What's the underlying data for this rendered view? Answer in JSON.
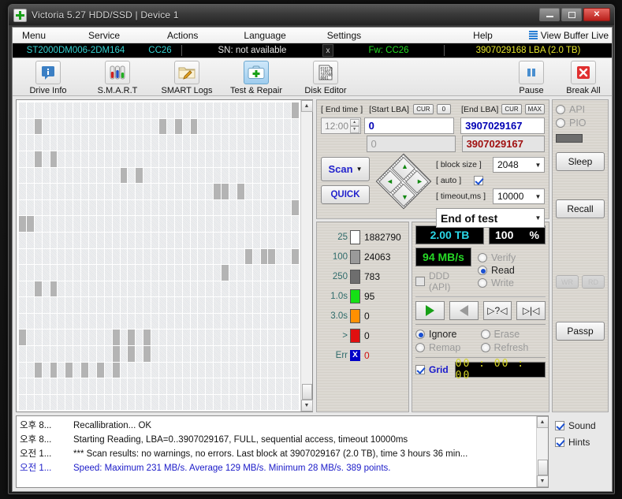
{
  "window": {
    "title": "Victoria 5.27 HDD/SSD | Device 1",
    "app_icon": "green-cross-icon",
    "minimize": "minimize-icon",
    "maximize": "maximize-icon",
    "close": "✕"
  },
  "menubar": {
    "items": [
      "Menu",
      "Service",
      "Actions",
      "Language",
      "Settings",
      "Help"
    ],
    "view_buffer_live": "View Buffer Live"
  },
  "drivebar": {
    "model": "ST2000DM006-2DM164",
    "revision": "CC26",
    "serial": "SN: not available",
    "x_button": "x",
    "firmware": "Fw: CC26",
    "capacity": "3907029168 LBA (2.0 TB)"
  },
  "toolbar": {
    "buttons": [
      {
        "label": "Drive Info",
        "icon": "info-icon",
        "selected": false
      },
      {
        "label": "S.M.A.R.T",
        "icon": "test-tubes-icon",
        "selected": false
      },
      {
        "label": "SMART Logs",
        "icon": "folder-pencil-icon",
        "selected": false
      },
      {
        "label": "Test & Repair",
        "icon": "first-aid-kit-icon",
        "selected": true
      },
      {
        "label": "Disk Editor",
        "icon": "binary-page-icon",
        "selected": false
      }
    ],
    "pause": {
      "label": "Pause",
      "icon": "pause-icon"
    },
    "break_all": {
      "label": "Break All",
      "icon": "red-x-icon"
    }
  },
  "params": {
    "end_time_label": "[ End time ]",
    "end_time_value": "12:00",
    "start_lba_label": "[Start LBA]",
    "start_cur": "CUR",
    "start_zero": "0",
    "start_lba_value": "0",
    "start_lba_readonly": "0",
    "end_lba_label": "[End LBA]",
    "end_cur": "CUR",
    "end_max": "MAX",
    "end_lba_value": "3907029167",
    "end_lba_second": "3907029167",
    "scan_button": "Scan",
    "scan_arrow": "▼",
    "quick_button": "QUICK",
    "block_size_label": "[ block size ]",
    "block_size_value": "2048",
    "auto_label": "[ auto ]",
    "auto_checked": true,
    "timeout_label": "[ timeout,ms ]",
    "timeout_value": "10000",
    "end_of_test_value": "End of test",
    "dpad": {
      "up": "▲",
      "down": "▼",
      "left": "◄",
      "right": "►"
    }
  },
  "stats": {
    "rows": [
      {
        "name": "25",
        "color": "#ffffff",
        "value": "1882790"
      },
      {
        "name": "100",
        "color": "#9a9a9a",
        "value": "24063"
      },
      {
        "name": "250",
        "color": "#6e6e6e",
        "value": "783"
      },
      {
        "name": "1.0s",
        "color": "#15e015",
        "value": "95"
      },
      {
        "name": "3.0s",
        "color": "#ff9000",
        "value": "0"
      },
      {
        "name": ">",
        "color": "#e01010",
        "value": "0"
      }
    ],
    "err_label": "Err",
    "err_icon": "blue-x-icon",
    "err_value": "0"
  },
  "control": {
    "capacity_lcd": "2.00 TB",
    "percent_value": "100",
    "percent_unit": "%",
    "speed_lcd": "94 MB/s",
    "ddd_label": "DDD (API)",
    "ddd_checked": false,
    "modes": [
      {
        "label": "Verify",
        "selected": false,
        "disabled": true
      },
      {
        "label": "Read",
        "selected": true,
        "disabled": false
      },
      {
        "label": "Write",
        "selected": false,
        "disabled": true
      }
    ],
    "transport": [
      {
        "name": "play-forward-button",
        "glyph": "▶"
      },
      {
        "name": "play-backward-button",
        "glyph": "◀"
      },
      {
        "name": "random-seek-button",
        "glyph": "▷?◁"
      },
      {
        "name": "butterfly-seek-button",
        "glyph": "▷|◁"
      }
    ],
    "actions": [
      {
        "label": "Ignore",
        "selected": true,
        "disabled": false
      },
      {
        "label": "Erase",
        "selected": false,
        "disabled": true
      },
      {
        "label": "Remap",
        "selected": false,
        "disabled": true
      },
      {
        "label": "Refresh",
        "selected": false,
        "disabled": true
      }
    ],
    "grid_label": "Grid",
    "grid_checked": true,
    "timer": "00 : 00 : 00"
  },
  "sidebar": {
    "api_label": "API",
    "api_selected": true,
    "pio_label": "PIO",
    "pio_selected": false,
    "sleep_button": "Sleep",
    "recall_button": "Recall",
    "wr_button": "WR",
    "rd_button": "RD",
    "passp_button": "Passp"
  },
  "log": {
    "lines": [
      {
        "time": "오후 8...",
        "text": "Recallibration... OK",
        "highlight": false
      },
      {
        "time": "오후 8...",
        "text": "Starting Reading, LBA=0..3907029167, FULL, sequential access, timeout 10000ms",
        "highlight": false
      },
      {
        "time": "오전 1...",
        "text": "*** Scan results: no warnings, no errors. Last block at 3907029167 (2.0 TB), time 3 hours 36 min...",
        "highlight": false
      },
      {
        "time": "오전 1...",
        "text": "Speed: Maximum 231 MB/s. Average 129 MB/s. Minimum 28 MB/s. 389 points.",
        "highlight": true
      }
    ],
    "sound_label": "Sound",
    "sound_checked": true,
    "hints_label": "Hints",
    "hints_checked": true
  },
  "map": {
    "columns": 36,
    "rows": 19,
    "dark_cells": [
      [
        0,
        35
      ],
      [
        1,
        2
      ],
      [
        1,
        18
      ],
      [
        1,
        20
      ],
      [
        1,
        22
      ],
      [
        3,
        2
      ],
      [
        3,
        4
      ],
      [
        4,
        13
      ],
      [
        4,
        15
      ],
      [
        5,
        25
      ],
      [
        5,
        26
      ],
      [
        5,
        28
      ],
      [
        6,
        35
      ],
      [
        7,
        0
      ],
      [
        7,
        1
      ],
      [
        9,
        29
      ],
      [
        9,
        31
      ],
      [
        9,
        32
      ],
      [
        9,
        35
      ],
      [
        10,
        26
      ],
      [
        11,
        2
      ],
      [
        11,
        4
      ],
      [
        14,
        0
      ],
      [
        14,
        12
      ],
      [
        14,
        14
      ],
      [
        14,
        16
      ],
      [
        15,
        12
      ],
      [
        15,
        14
      ],
      [
        15,
        16
      ],
      [
        16,
        2
      ],
      [
        16,
        4
      ],
      [
        16,
        6
      ],
      [
        16,
        8
      ],
      [
        16,
        10
      ],
      [
        16,
        12
      ]
    ]
  }
}
